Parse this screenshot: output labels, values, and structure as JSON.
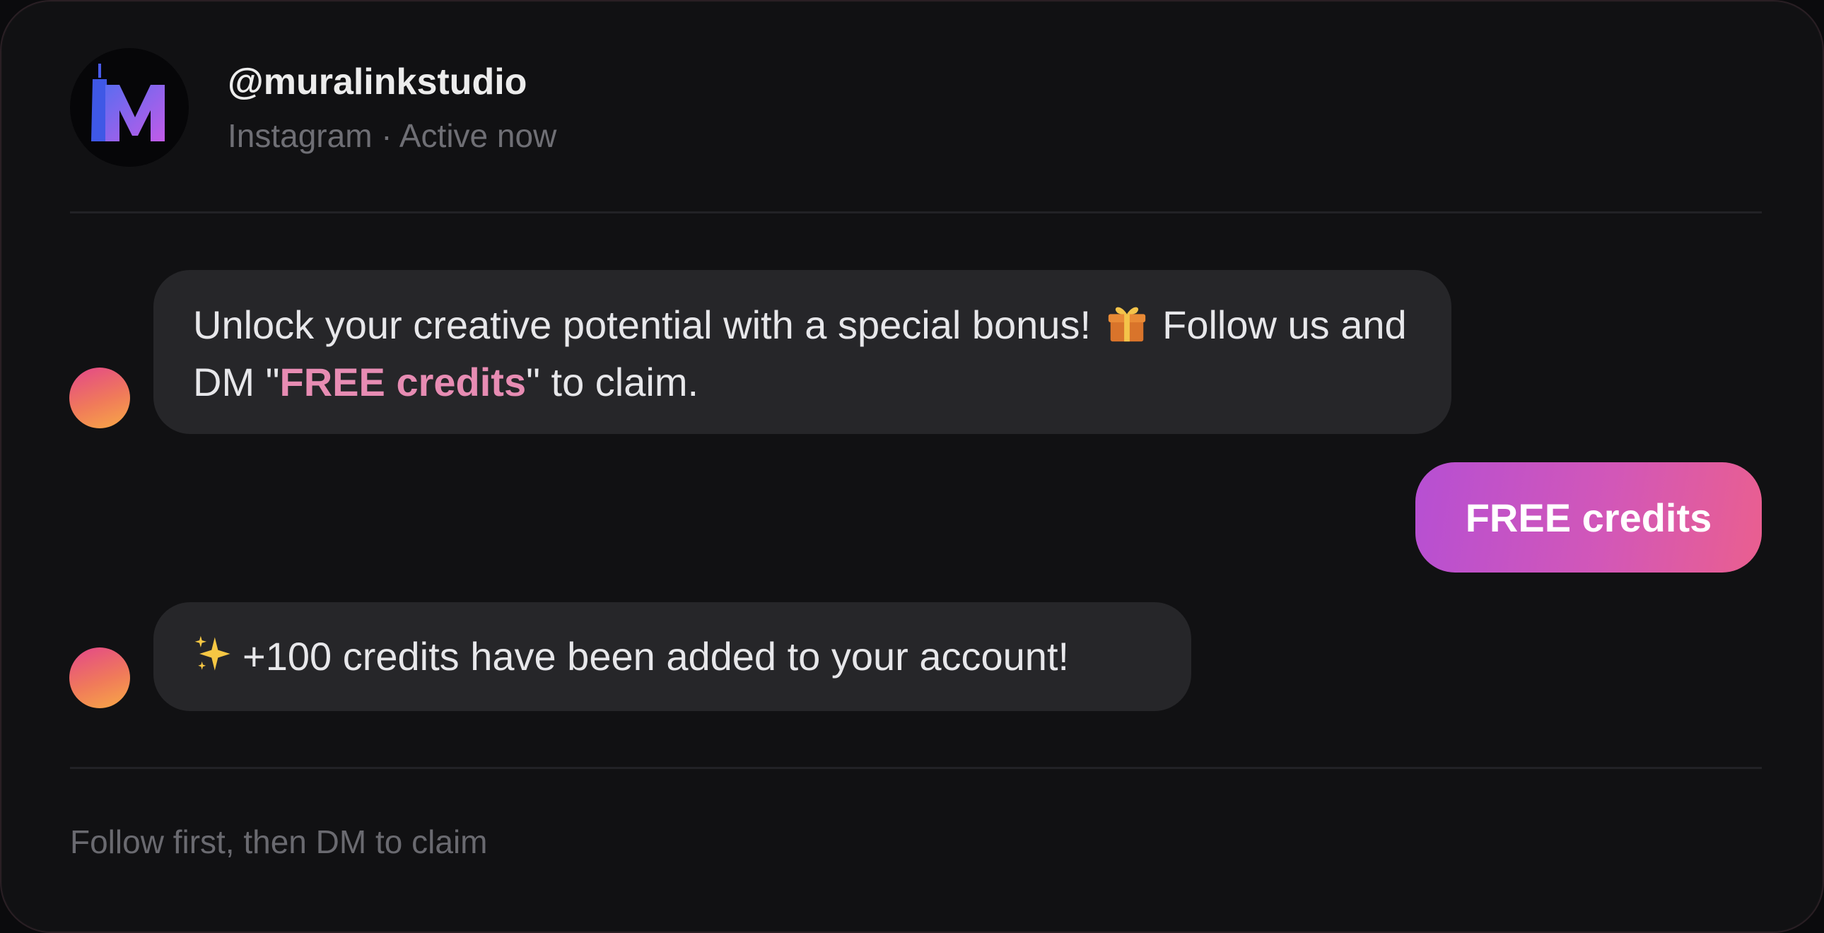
{
  "header": {
    "handle": "@muralinkstudio",
    "subline": "Instagram · Active now",
    "avatar_icon": "muralink-m-logo-icon"
  },
  "messages": [
    {
      "direction": "incoming",
      "text_part1": "Unlock your creative potential with a special bonus!",
      "emoji": "gift-icon",
      "text_part2": "Follow us and DM \"",
      "highlight": "FREE credits",
      "text_part3": "\" to claim."
    },
    {
      "direction": "outgoing",
      "text": "FREE credits"
    },
    {
      "direction": "incoming",
      "emoji": "sparkles-icon",
      "text": "+100 credits have been added to your account!"
    }
  ],
  "footer": {
    "note": "Follow first, then DM to claim"
  },
  "colors": {
    "background": "#111113",
    "bubble_incoming": "#262629",
    "highlight": "#e78cb3",
    "outgoing_gradient_start": "#b64fd3",
    "outgoing_gradient_end": "#ea5f8f"
  }
}
